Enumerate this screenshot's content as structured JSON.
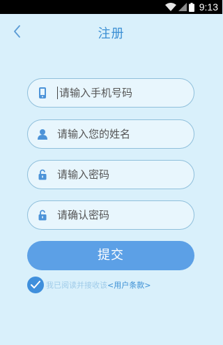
{
  "status_bar": {
    "time": "9:13",
    "icons": [
      "wifi-icon",
      "signal-icon",
      "battery-icon"
    ],
    "background": "#000000"
  },
  "header": {
    "title": "注册",
    "back_icon": "chevron-left-icon",
    "title_color": "#3b8fd4"
  },
  "form": {
    "phone": {
      "placeholder": "请输入手机号码",
      "value": "",
      "icon": "phone-icon"
    },
    "name": {
      "placeholder": "请输入您的姓名",
      "value": "",
      "icon": "user-icon"
    },
    "password": {
      "placeholder": "请输入密码",
      "value": "",
      "icon": "lock-icon"
    },
    "confirm_password": {
      "placeholder": "请确认密码",
      "value": "",
      "icon": "lock-icon"
    }
  },
  "submit": {
    "label": "提交",
    "color": "#5ca0e6"
  },
  "agreement": {
    "checked": true,
    "text": "我已阅读并接收该",
    "link": "<用户条款>"
  },
  "colors": {
    "background": "#d9f0fb",
    "accent": "#3b8fd4",
    "field_border": "#8fbfdb"
  }
}
